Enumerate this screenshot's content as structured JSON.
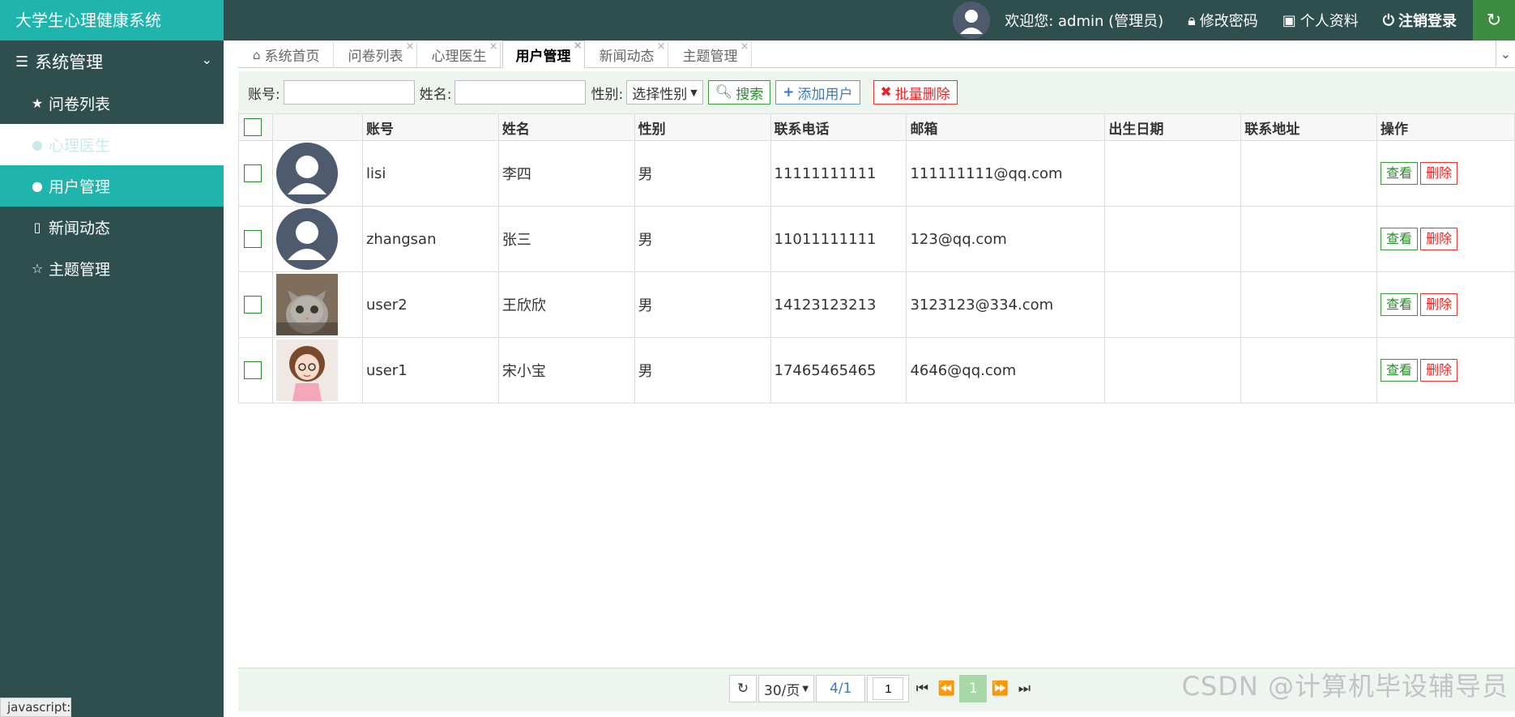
{
  "app": {
    "title": "大学生心理健康系统"
  },
  "topbar": {
    "welcome": "欢迎您: admin (管理员)",
    "change_password": "修改密码",
    "profile": "个人资料",
    "logout": "注销登录"
  },
  "sidebar": {
    "group": "系统管理",
    "items": [
      {
        "label": "问卷列表",
        "icon": "star-icon"
      },
      {
        "label": "心理医生",
        "icon": "user-icon"
      },
      {
        "label": "用户管理",
        "icon": "user-icon"
      },
      {
        "label": "新闻动态",
        "icon": "file-pdf-icon"
      },
      {
        "label": "主题管理",
        "icon": "star-outline-icon"
      }
    ]
  },
  "tabs": [
    {
      "label": "系统首页"
    },
    {
      "label": "问卷列表"
    },
    {
      "label": "心理医生"
    },
    {
      "label": "用户管理"
    },
    {
      "label": "新闻动态"
    },
    {
      "label": "主题管理"
    }
  ],
  "search": {
    "account_label": "账号:",
    "name_label": "姓名:",
    "gender_label": "性别:",
    "gender_select": "选择性别",
    "search_btn": "搜索",
    "add_btn": "添加用户",
    "batch_delete_btn": "批量删除"
  },
  "table": {
    "headers": [
      "账号",
      "姓名",
      "性别",
      "联系电话",
      "邮箱",
      "出生日期",
      "联系地址",
      "操作"
    ],
    "rows": [
      {
        "account": "lisi",
        "name": "李四",
        "gender": "男",
        "phone": "11111111111",
        "email": "111111111@qq.com",
        "birth": "",
        "address": ""
      },
      {
        "account": "zhangsan",
        "name": "张三",
        "gender": "男",
        "phone": "11011111111",
        "email": "123@qq.com",
        "birth": "",
        "address": ""
      },
      {
        "account": "user2",
        "name": "王欣欣",
        "gender": "男",
        "phone": "14123123213",
        "email": "3123123@334.com",
        "birth": "",
        "address": ""
      },
      {
        "account": "user1",
        "name": "宋小宝",
        "gender": "男",
        "phone": "17465465465",
        "email": "4646@qq.com",
        "birth": "",
        "address": ""
      }
    ],
    "view_btn": "查看",
    "delete_btn": "删除"
  },
  "pager": {
    "page_size": "30/页",
    "page_info": "4/1",
    "page_input": "1",
    "current_page": "1"
  },
  "status_bar": "javascript:",
  "watermark": "CSDN @计算机毕设辅导员",
  "colors": {
    "brand": "#1fb5ad",
    "sidebar": "#2f4f4f",
    "refresh": "#3d8b40"
  }
}
